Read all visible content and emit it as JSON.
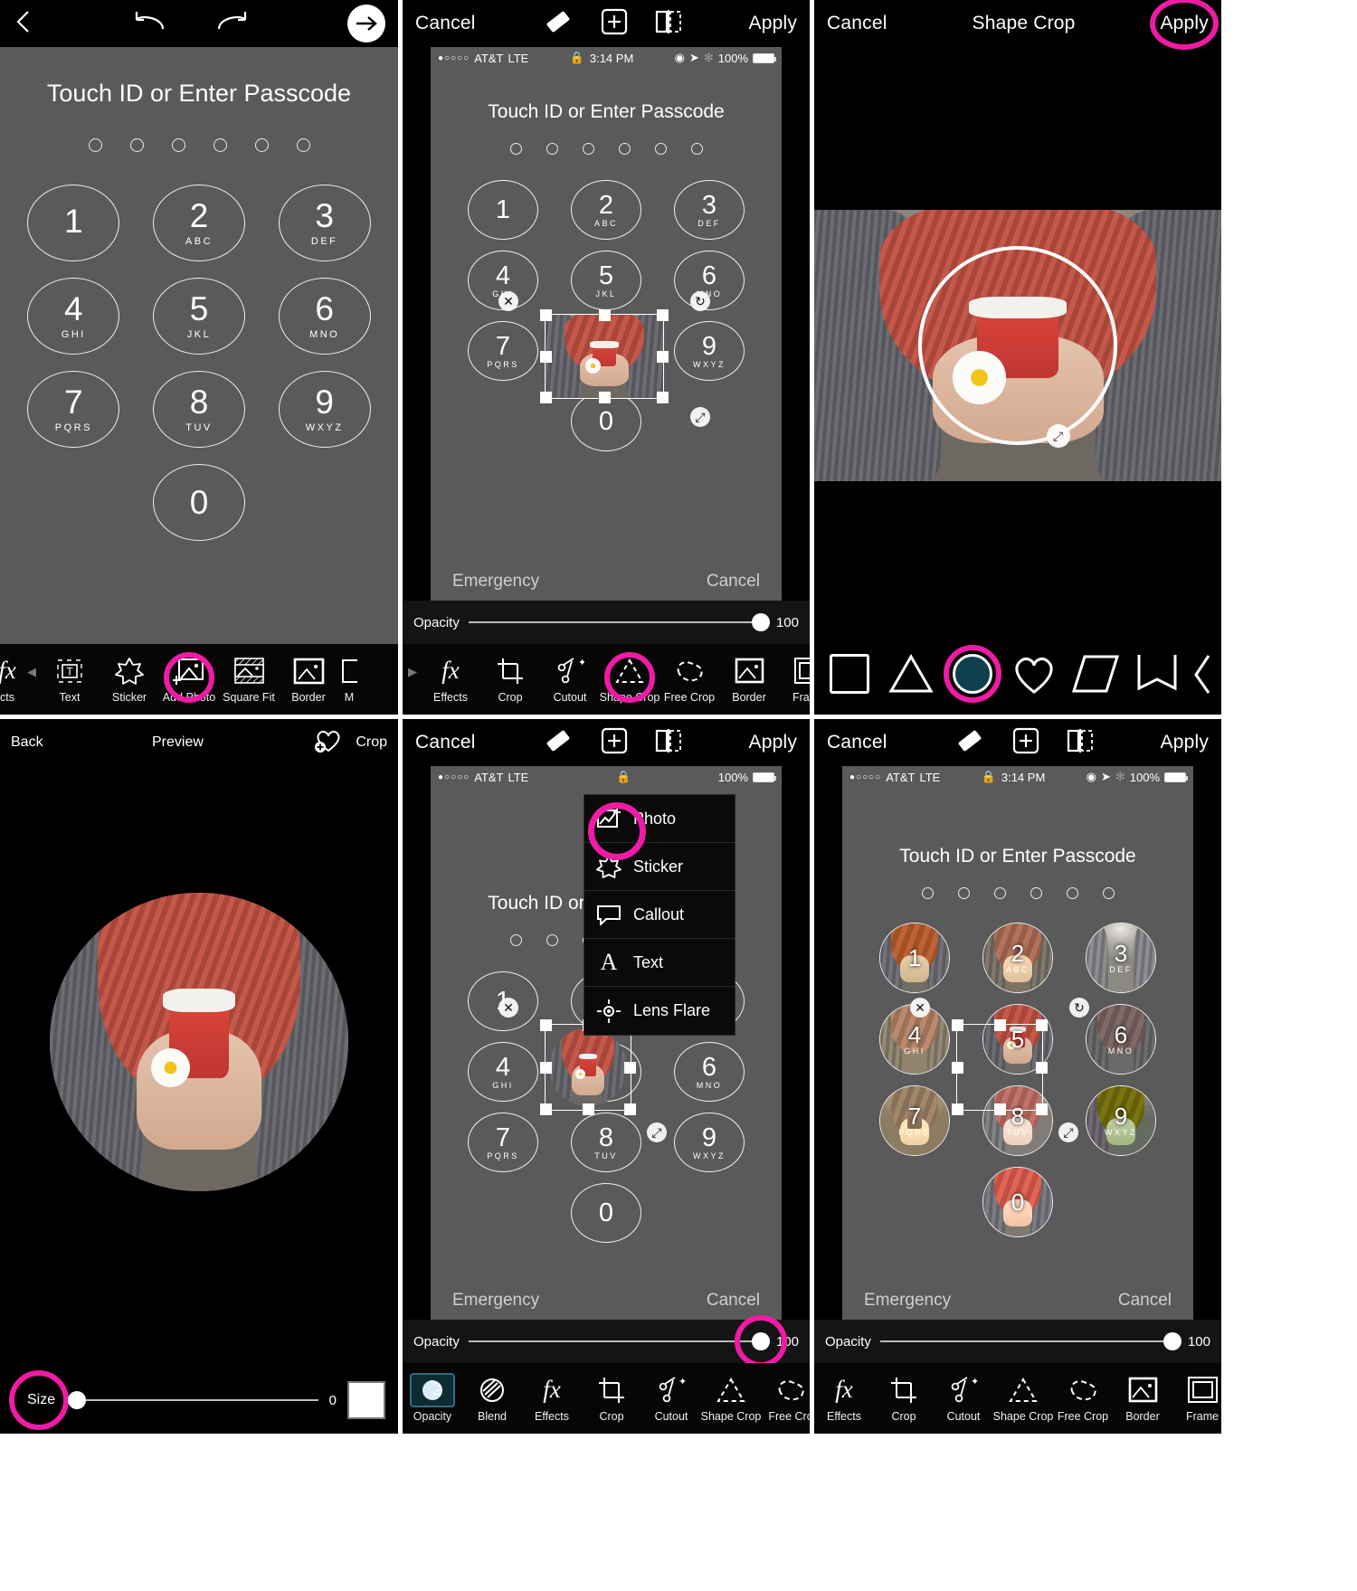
{
  "app": {
    "name": "Photo editor app collage"
  },
  "panel1": {
    "name": "editor-canvas-add-photo",
    "topbar": {
      "back_icon": "chevron-left-icon",
      "undo_icon": "undo-icon",
      "redo_icon": "redo-icon",
      "next_icon": "arrow-right-icon"
    },
    "lockscreen": {
      "title": "Touch ID or Enter Passcode",
      "dots": 6,
      "keys": [
        {
          "num": "1",
          "ltr": ""
        },
        {
          "num": "2",
          "ltr": "ABC"
        },
        {
          "num": "3",
          "ltr": "DEF"
        },
        {
          "num": "4",
          "ltr": "GHI"
        },
        {
          "num": "5",
          "ltr": "JKL"
        },
        {
          "num": "6",
          "ltr": "MNO"
        },
        {
          "num": "7",
          "ltr": "PQRS"
        },
        {
          "num": "8",
          "ltr": "TUV"
        },
        {
          "num": "9",
          "ltr": "WXYZ"
        },
        {
          "num": "0",
          "ltr": ""
        }
      ],
      "emergency": "Emergency",
      "cancel": "Cancel"
    },
    "tools": [
      {
        "label": "cts",
        "icon": "fx-icon"
      },
      {
        "label": "Text",
        "icon": "text-icon"
      },
      {
        "label": "Sticker",
        "icon": "sticker-star-icon"
      },
      {
        "label": "Add Photo",
        "icon": "add-photo-icon",
        "highlighted": true
      },
      {
        "label": "Square Fit",
        "icon": "square-fit-icon"
      },
      {
        "label": "Border",
        "icon": "border-icon"
      },
      {
        "label": "M",
        "icon": "more-icon"
      }
    ]
  },
  "panel2": {
    "name": "shape-crop-tool-highlight",
    "topbar": {
      "cancel": "Cancel",
      "apply": "Apply",
      "eraser_icon": "eraser-icon",
      "add_icon": "plus-square-icon",
      "mirror_icon": "mirror-icon"
    },
    "statusbar": {
      "carrier": "AT&T",
      "network": "LTE",
      "time": "3:14 PM",
      "battery": "100%",
      "lock_icon": "lock-icon",
      "location_icon": "location-arrow-icon",
      "bluetooth_icon": "bluetooth-icon",
      "rotation_icon": "rotation-lock-icon"
    },
    "opacity": {
      "label": "Opacity",
      "value": "100"
    },
    "tools": [
      {
        "label": "Effects",
        "icon": "fx-icon"
      },
      {
        "label": "Crop",
        "icon": "crop-icon"
      },
      {
        "label": "Cutout",
        "icon": "cutout-scissors-icon"
      },
      {
        "label": "Shape Crop",
        "icon": "shape-crop-triangle-icon",
        "highlighted": true
      },
      {
        "label": "Free Crop",
        "icon": "free-crop-icon"
      },
      {
        "label": "Border",
        "icon": "border-icon"
      },
      {
        "label": "Frame",
        "icon": "frame-icon"
      }
    ]
  },
  "panel3": {
    "name": "shape-crop-circle-selection",
    "topbar": {
      "cancel": "Cancel",
      "title": "Shape Crop",
      "apply": "Apply",
      "apply_highlighted": true
    },
    "shapes": [
      {
        "name": "square-shape",
        "selected": false
      },
      {
        "name": "triangle-shape",
        "selected": false
      },
      {
        "name": "circle-shape",
        "selected": true
      },
      {
        "name": "heart-shape",
        "selected": false
      },
      {
        "name": "parallelogram-shape",
        "selected": false
      },
      {
        "name": "banner-shape",
        "selected": false
      },
      {
        "name": "partial-shape",
        "selected": false
      }
    ],
    "resize_handle_icon": "resize-diagonal-icon"
  },
  "panel4": {
    "name": "preview-cropped-circle",
    "topbar": {
      "back": "Back",
      "title": "Preview",
      "crop": "Crop",
      "heart_plus_icon": "heart-plus-icon"
    },
    "size": {
      "label": "Size",
      "value": "0",
      "highlighted": true
    },
    "swatch_name": "white-color-swatch"
  },
  "panel5": {
    "name": "add-menu-open",
    "topbar": {
      "cancel": "Cancel",
      "apply": "Apply",
      "eraser_icon": "eraser-icon",
      "add_icon": "plus-square-icon",
      "mirror_icon": "mirror-icon"
    },
    "statusbar": {
      "carrier": "AT&T",
      "network": "LTE",
      "battery": "100%"
    },
    "menu": [
      {
        "label": "Photo",
        "icon": "photo-add-icon",
        "highlighted": true
      },
      {
        "label": "Sticker",
        "icon": "sticker-star-icon"
      },
      {
        "label": "Callout",
        "icon": "callout-bubble-icon"
      },
      {
        "label": "Text",
        "icon": "text-a-icon"
      },
      {
        "label": "Lens Flare",
        "icon": "lens-flare-icon"
      }
    ],
    "opacity": {
      "label": "Opacity",
      "value": "100",
      "highlighted": true
    },
    "tools": [
      {
        "label": "Opacity",
        "icon": "opacity-icon",
        "selected": true
      },
      {
        "label": "Blend",
        "icon": "blend-icon"
      },
      {
        "label": "Effects",
        "icon": "fx-icon"
      },
      {
        "label": "Crop",
        "icon": "crop-icon"
      },
      {
        "label": "Cutout",
        "icon": "cutout-scissors-icon"
      },
      {
        "label": "Shape Crop",
        "icon": "shape-crop-triangle-icon"
      },
      {
        "label": "Free Cro",
        "icon": "free-crop-icon"
      }
    ]
  },
  "panel6": {
    "name": "all-keys-filled-with-photos",
    "topbar": {
      "cancel": "Cancel",
      "apply": "Apply",
      "eraser_icon": "eraser-icon",
      "add_icon": "plus-square-icon",
      "mirror_icon": "mirror-icon"
    },
    "statusbar": {
      "carrier": "AT&T",
      "network": "LTE",
      "time": "3:14 PM",
      "battery": "100%"
    },
    "lockscreen_title": "Touch ID or Enter Passcode",
    "opacity": {
      "label": "Opacity",
      "value": "100"
    },
    "tools": [
      {
        "label": "Effects",
        "icon": "fx-icon"
      },
      {
        "label": "Crop",
        "icon": "crop-icon"
      },
      {
        "label": "Cutout",
        "icon": "cutout-scissors-icon"
      },
      {
        "label": "Shape Crop",
        "icon": "shape-crop-triangle-icon"
      },
      {
        "label": "Free Crop",
        "icon": "free-crop-icon"
      },
      {
        "label": "Border",
        "icon": "border-icon"
      },
      {
        "label": "Frame",
        "icon": "frame-icon"
      }
    ]
  },
  "colors": {
    "accent": "#ef1ba5",
    "lock_bg": "#5a5a5a",
    "rail_bg": "#060606",
    "selected_tile": "#10404d"
  }
}
